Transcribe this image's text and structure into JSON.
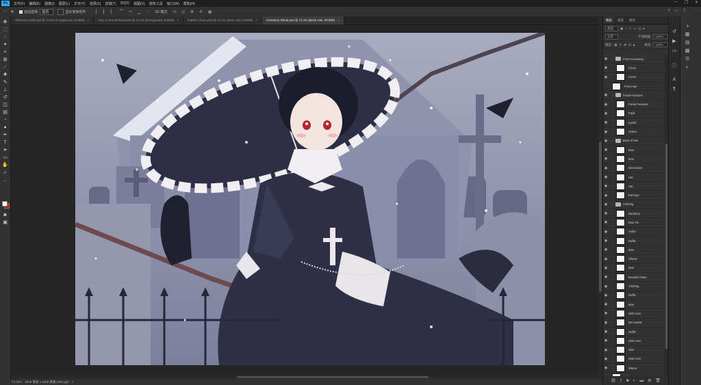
{
  "menu": {
    "logo": "Ps",
    "items": [
      "文件(F)",
      "编辑(E)",
      "图像(I)",
      "图层(L)",
      "文字(Y)",
      "选择(S)",
      "滤镜(T)",
      "3D(D)",
      "视图(V)",
      "增效工具",
      "窗口(W)",
      "帮助(H)"
    ]
  },
  "window_controls": [
    "—",
    "❐",
    "✕"
  ],
  "options": {
    "auto_select_label": "自动选择:",
    "auto_select_value": "图层",
    "show_transform_label": "显示变换控件",
    "mode_label": "3D 模式:"
  },
  "tabs": [
    {
      "label": "Afternoon Café.psd @ 73.3% (Foreground, RGB/8)",
      "close": "×"
    },
    {
      "label": "Alice in Wonderland.psd @ 73.3% (Foreground, RGB/8)",
      "close": "×"
    },
    {
      "label": "Rabbit Chaos.psd @ 73.3% (Back Hair, RGB/8)",
      "close": "×"
    },
    {
      "label": "Cemetery Ritual.psd @ 73.3% (Back Hair, RGB/8)",
      "close": "×",
      "active": true
    }
  ],
  "status": {
    "zoom": "73.33%",
    "doc_info": "3508 像素 x 2480 像素 (300 ppi)",
    "arrow": ">"
  },
  "panel": {
    "tabs": [
      "图层",
      "通道",
      "路径"
    ],
    "kind_label": "类型",
    "blend_mode": "正常",
    "opacity_label": "不透明度:",
    "opacity_value": "100%",
    "lock_label": "锁定:",
    "fill_label": "填充:",
    "fill_value": "100%"
  },
  "layers": [
    {
      "name": "Front Accessory",
      "type": "group",
      "level": 1,
      "visible": true
    },
    {
      "name": "Cross",
      "type": "layer",
      "level": 2,
      "visible": true
    },
    {
      "name": "Cross",
      "type": "layer",
      "level": 2,
      "visible": true
    },
    {
      "name": "Front Hair",
      "type": "layer",
      "level": 1,
      "visible": false
    },
    {
      "name": "Facial Features",
      "type": "group",
      "level": 1,
      "visible": true
    },
    {
      "name": "Facial Features",
      "type": "layer",
      "level": 2,
      "visible": true
    },
    {
      "name": "Pupil",
      "type": "layer",
      "level": 2,
      "visible": true
    },
    {
      "name": "Eyelid",
      "type": "layer",
      "level": 2,
      "visible": true
    },
    {
      "name": "Sclera",
      "type": "layer",
      "level": 2,
      "visible": true
    },
    {
      "name": "Back of Hat",
      "type": "group",
      "level": 1,
      "visible": true
    },
    {
      "name": "Bow",
      "type": "layer",
      "level": 2,
      "visible": true
    },
    {
      "name": "Bow",
      "type": "layer",
      "level": 2,
      "visible": true
    },
    {
      "name": "Decoration",
      "type": "layer",
      "level": 2,
      "visible": true
    },
    {
      "name": "Hat",
      "type": "layer",
      "level": 2,
      "visible": true
    },
    {
      "name": "Hat",
      "type": "layer",
      "level": 2,
      "visible": true
    },
    {
      "name": "Earrings",
      "type": "layer",
      "level": 2,
      "visible": true
    },
    {
      "name": "Clothing",
      "type": "group",
      "level": 1,
      "visible": true
    },
    {
      "name": "Necklace",
      "type": "layer",
      "level": 2,
      "visible": true
    },
    {
      "name": "Bow Tie",
      "type": "layer",
      "level": 2,
      "visible": true
    },
    {
      "name": "Collar",
      "type": "layer",
      "level": 2,
      "visible": true
    },
    {
      "name": "Ruffle",
      "type": "layer",
      "level": 2,
      "visible": true
    },
    {
      "name": "Bow",
      "type": "layer",
      "level": 2,
      "visible": true
    },
    {
      "name": "Sleeve",
      "type": "layer",
      "level": 2,
      "visible": true
    },
    {
      "name": "Bow",
      "type": "layer",
      "level": 2,
      "visible": true
    },
    {
      "name": "Beaded Chain",
      "type": "layer",
      "level": 2,
      "visible": true
    },
    {
      "name": "Clothing",
      "type": "layer",
      "level": 2,
      "visible": true
    },
    {
      "name": "Ruffle",
      "type": "layer",
      "level": 2,
      "visible": true
    },
    {
      "name": "Bow",
      "type": "layer",
      "level": 2,
      "visible": true
    },
    {
      "name": "Skirt Hem",
      "type": "layer",
      "level": 2,
      "visible": true
    },
    {
      "name": "Decoration",
      "type": "layer",
      "level": 2,
      "visible": true
    },
    {
      "name": "Ruffle",
      "type": "layer",
      "level": 2,
      "visible": true
    },
    {
      "name": "Skirt Hem",
      "type": "layer",
      "level": 2,
      "visible": true
    },
    {
      "name": "Skirt",
      "type": "layer",
      "level": 2,
      "visible": true
    },
    {
      "name": "Skirt Hem",
      "type": "layer",
      "level": 2,
      "visible": true
    },
    {
      "name": "Sleeve",
      "type": "layer",
      "level": 2,
      "visible": true
    },
    {
      "name": "Skin Tone",
      "type": "layer",
      "level": 1,
      "visible": true
    },
    {
      "name": "Back Hair",
      "type": "layer",
      "level": 1,
      "visible": true,
      "selected": true
    }
  ],
  "panel_bottom_icons": [
    "link-icon",
    "fx-icon",
    "mask-icon",
    "adjustment-icon",
    "group-icon",
    "new-layer-icon",
    "trash-icon"
  ],
  "colors": {
    "foreground": "#ffffff",
    "background": "#c11414",
    "accent": "#31a8ff",
    "ui_dark": "#2b2b2b"
  }
}
